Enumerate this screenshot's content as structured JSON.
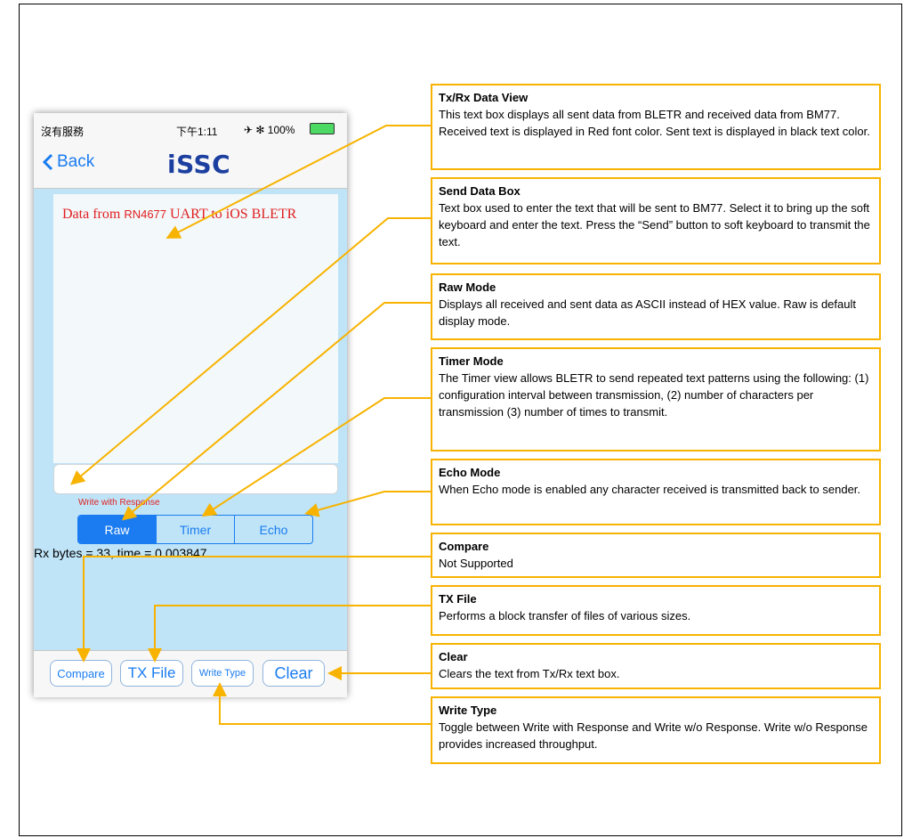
{
  "phone": {
    "status": {
      "carrier": "沒有服務",
      "time": "下午1:11",
      "right": "✈ ✻ 100%"
    },
    "nav": {
      "back_label": "Back",
      "logo": "iSSC"
    },
    "data_view": {
      "text_a": "Data from ",
      "text_b": "RN4677",
      "text_c": " UART to iOS BLETR"
    },
    "write_type_label": "Write with Response",
    "segments": [
      "Raw",
      "Timer",
      "Echo"
    ],
    "rx_status": "Rx bytes = 33, time = 0.003847",
    "toolbar": [
      "Compare",
      "TX File",
      "Write Type",
      "Clear"
    ]
  },
  "callouts": [
    {
      "title": "Tx/Rx  Data View",
      "body": "This text box displays all sent data from BLETR and received data from BM77. Received text is displayed in Red font color. Sent text is displayed in black text color."
    },
    {
      "title": "Send Data Box",
      "body": "Text box used to enter the text that will be sent to BM77. Select it to bring  up the soft keyboard  and enter the text.  Press the “Send” button to soft keyboard to transmit the text."
    },
    {
      "title": "Raw Mode",
      "body": "Displays all received and sent data as ASCII instead of HEX value. Raw is default display mode."
    },
    {
      "title": "Timer Mode",
      "body": "The Timer view allows BLETR to send repeated text patterns using the following: (1) configuration interval between transmission, (2) number of characters per transmission (3) number  of times to transmit."
    },
    {
      "title": "Echo Mode",
      "body": "When Echo mode  is enabled any character received is transmitted back to sender."
    },
    {
      "title": "Compare",
      "body": "Not Supported"
    },
    {
      "title": "TX File",
      "body": "Performs  a block transfer of files of various sizes."
    },
    {
      "title": "Clear",
      "body": "Clears the text from  Tx/Rx text box."
    },
    {
      "title": "Write Type",
      "body": "Toggle between Write with Response and Write w/o Response. Write w/o Response provides increased throughput."
    }
  ],
  "colors": {
    "accent": "#1a7cf0",
    "callout_border": "#f7b300",
    "received_text": "#e02020"
  }
}
